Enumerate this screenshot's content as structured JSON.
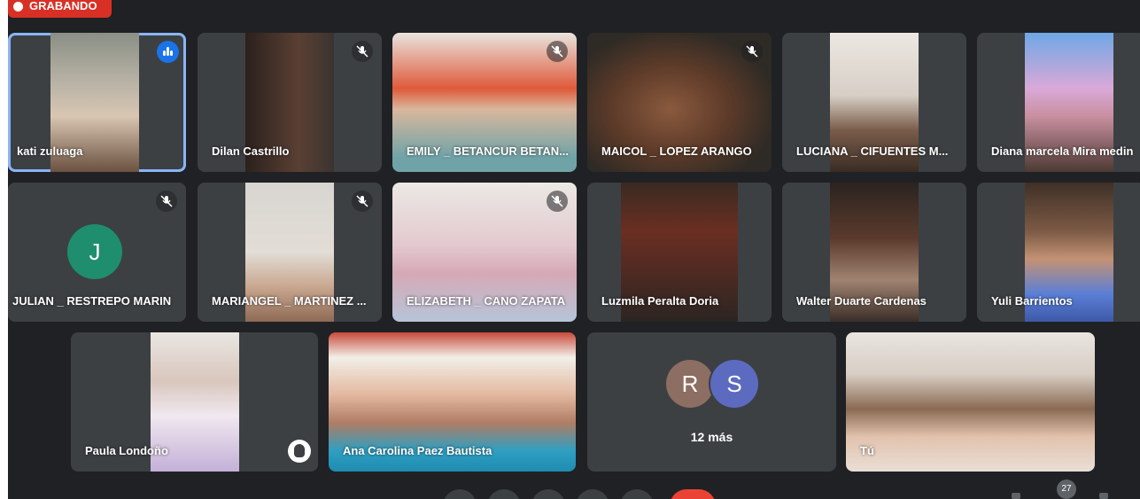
{
  "recording": {
    "label": "GRABANDO"
  },
  "tiles": [
    {
      "name": "kati zuluaga"
    },
    {
      "name": "Dilan Castrillo"
    },
    {
      "name": "EMILY _ BETANCUR BETAN..."
    },
    {
      "name": "MAICOL _ LOPEZ ARANGO"
    },
    {
      "name": "LUCIANA _ CIFUENTES M..."
    },
    {
      "name": "Diana marcela Mira medin"
    },
    {
      "name": "JULIAN _ RESTREPO MARIN",
      "avatar_letter": "J",
      "avatar_color": "#1e8e6e"
    },
    {
      "name": "MARIANGEL _ MARTINEZ ..."
    },
    {
      "name": "ELIZABETH _ CANO ZAPATA"
    },
    {
      "name": "Luzmila Peralta Doria"
    },
    {
      "name": "Walter Duarte Cardenas"
    },
    {
      "name": "Yuli Barrientos"
    },
    {
      "name": "Paula Londoño"
    },
    {
      "name": "Ana Carolina Paez Bautista"
    },
    {
      "name": "Tú"
    }
  ],
  "more_tile": {
    "label": "12 más",
    "avatars": [
      {
        "letter": "R",
        "color": "#8d6e63"
      },
      {
        "letter": "S",
        "color": "#5c6bc0"
      }
    ]
  },
  "toolbar": {
    "participants_count": "27"
  },
  "colors": {
    "background": "#202124",
    "tile": "#3c4043",
    "active_border": "#8ab4f8",
    "record": "#d93025",
    "hangup": "#ea4335"
  }
}
